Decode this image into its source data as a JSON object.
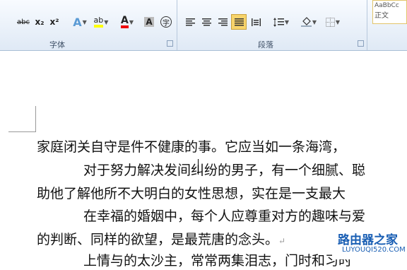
{
  "ribbon": {
    "font_group_label": "字体",
    "paragraph_group_label": "段落",
    "font_buttons": [
      {
        "name": "strikethrough-button",
        "glyph": "abc"
      },
      {
        "name": "subscript-button",
        "glyph": "x₂"
      },
      {
        "name": "superscript-button",
        "glyph": "x²"
      },
      {
        "name": "text-effects-button",
        "glyph": "A"
      },
      {
        "name": "highlight-button",
        "glyph": "ab"
      },
      {
        "name": "font-color-button",
        "glyph": "A"
      },
      {
        "name": "char-shading-button",
        "glyph": "A"
      },
      {
        "name": "enclose-char-button",
        "glyph": "字"
      }
    ],
    "style_preview": "AaBbCc",
    "style_preview_zh": "正文"
  },
  "document": {
    "lines": [
      "家庭闭关自守是件不健康的事。它应当如一条海湾，",
      "对于努力解决发间纠纷的男子，有一个细腻、聪",
      "助他了解他所不大明白的女性思想，实在是一支最大",
      "在幸福的婚姻中，每个人应尊重对方的趣味与爱",
      "的判断、同样的欲望，是最荒唐的念头。",
      "上情与的太沙主，常常两集泪志，门时和习时"
    ],
    "paragraph_mark": "↵"
  },
  "watermark": {
    "title": "路由器之家",
    "url": "LUYOUQI520.COM"
  }
}
